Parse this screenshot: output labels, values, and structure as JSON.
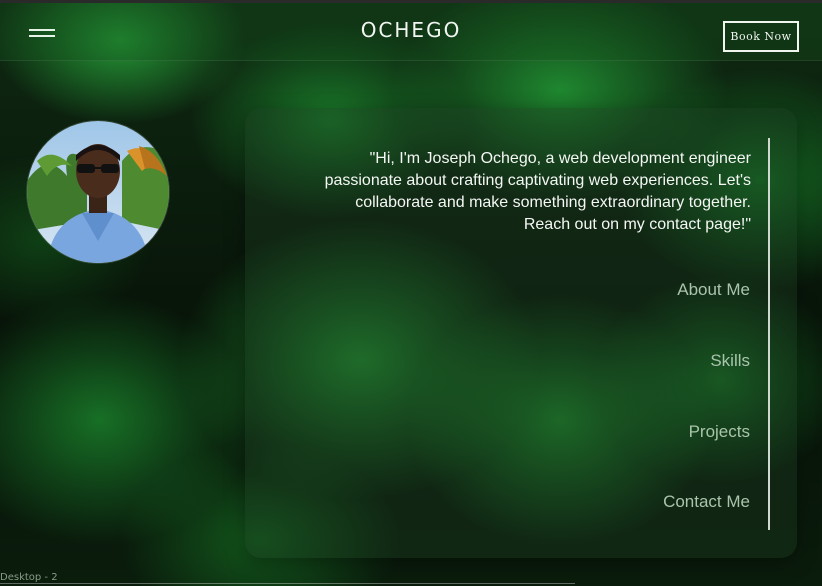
{
  "header": {
    "logo": "OCHEGO",
    "book_label": "Book Now",
    "menu_icon": "hamburger-menu-icon"
  },
  "profile": {
    "avatar_icon": "profile-photo"
  },
  "card": {
    "quote": "\"Hi, I'm Joseph Ochego, a web development engineer passionate about crafting captivating web experiences. Let's collaborate and make something extraordinary together. Reach out on my contact page!\"",
    "nav": [
      {
        "label": "About Me"
      },
      {
        "label": "Skills"
      },
      {
        "label": "Projects"
      },
      {
        "label": "Contact Me"
      }
    ]
  },
  "canvas": {
    "frame_label": "Desktop - 2"
  },
  "colors": {
    "accent_green": "#1f9e3a",
    "text_light": "#f4f7f4",
    "nav_text": "#a9c4ab"
  }
}
